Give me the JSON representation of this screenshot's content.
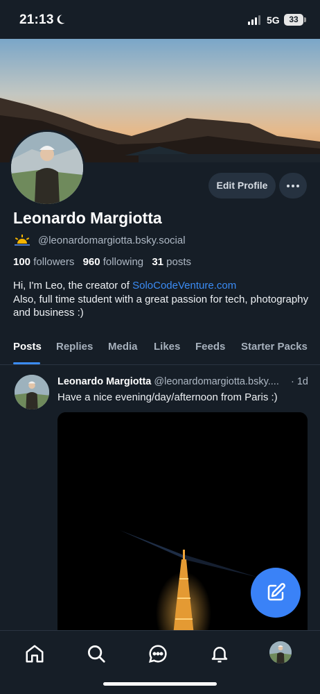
{
  "status_bar": {
    "time": "21:13",
    "network": "5G",
    "battery": "33"
  },
  "profile": {
    "display_name": "Leonardo Margiotta",
    "handle": "@leonardomargiotta.bsky.social",
    "followers_count": "100",
    "followers_label": "followers",
    "following_count": "960",
    "following_label": "following",
    "posts_count": "31",
    "posts_label": "posts",
    "bio_prefix": "Hi, I'm Leo, the creator of ",
    "bio_link": "SoloCodeVenture.com",
    "bio_rest": "Also, full time student with a great passion for tech, photography and business :)",
    "edit_label": "Edit Profile"
  },
  "tabs": [
    {
      "label": "Posts",
      "active": true
    },
    {
      "label": "Replies"
    },
    {
      "label": "Media"
    },
    {
      "label": "Likes"
    },
    {
      "label": "Feeds"
    },
    {
      "label": "Starter Packs"
    }
  ],
  "post": {
    "author": "Leonardo Margiotta",
    "handle": "@leonardomargiotta.bsky....",
    "time": "· 1d",
    "text": "Have a nice evening/day/afternoon from Paris :)"
  },
  "colors": {
    "accent": "#3b8cf5",
    "background": "#161e27",
    "fab": "#3a82f7"
  },
  "icons": {
    "nav": [
      "home-icon",
      "search-icon",
      "chat-icon",
      "bell-icon",
      "avatar"
    ],
    "fab": "compose-icon",
    "status": [
      "moon-icon",
      "signal-icon",
      "battery-icon"
    ]
  }
}
